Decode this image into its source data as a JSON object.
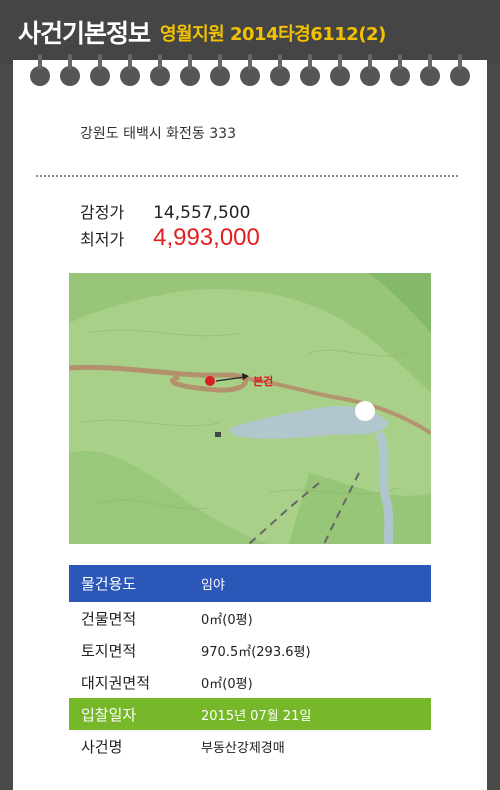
{
  "header": {
    "title": "사건기본정보",
    "case_info": "영월지원 2014타경6112(2)"
  },
  "address": "강원도 태백시 화전동 333",
  "prices": {
    "appraisal_label": "감정가",
    "appraisal_value": "14,557,500",
    "minimum_label": "최저가",
    "minimum_value": "4,993,000"
  },
  "map": {
    "marker_label": "본건"
  },
  "details": [
    {
      "key": "물건용도",
      "value": "임야"
    },
    {
      "key": "건물면적",
      "value": "0㎡(0평)"
    },
    {
      "key": "토지면적",
      "value": "970.5㎡(293.6평)"
    },
    {
      "key": "대지권면적",
      "value": "0㎡(0평)"
    },
    {
      "key": "입찰일자",
      "value": "2015년 07월 21일"
    },
    {
      "key": "사건명",
      "value": "부동산강제경매"
    }
  ],
  "colors": {
    "header_accent": "#f2c200",
    "min_price": "#e02020",
    "row_blue": "#2a57b8",
    "row_green": "#77b82a"
  }
}
